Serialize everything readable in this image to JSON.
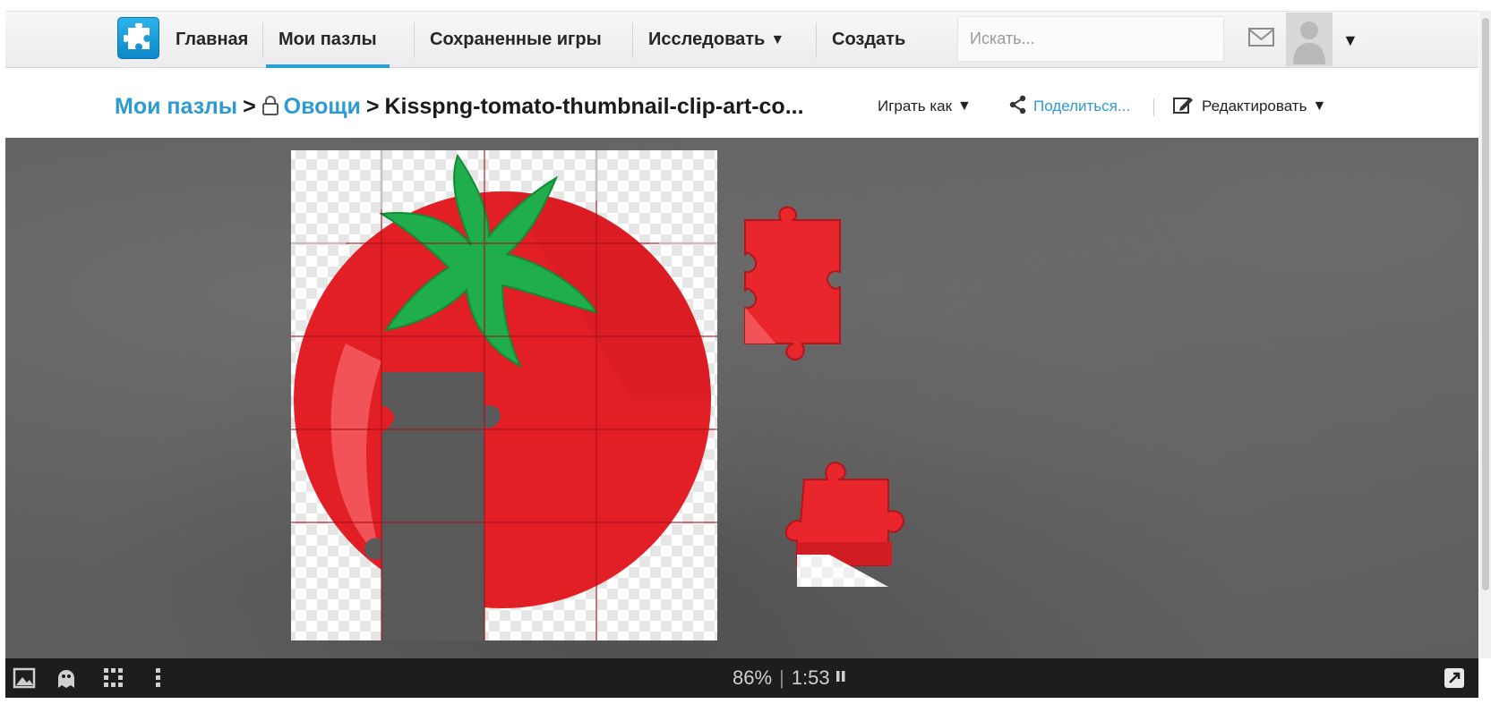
{
  "nav": {
    "home": "Главная",
    "my_puzzles": "Мои пазлы",
    "saved_games": "Сохраненные игры",
    "explore": "Исследовать",
    "create": "Создать"
  },
  "search": {
    "placeholder": "Искать..."
  },
  "breadcrumb": {
    "root": "Мои пазлы",
    "sep": ">",
    "folder": "Овощи",
    "title": "Kisspng-tomato-thumbnail-clip-art-co..."
  },
  "actions": {
    "play_as": "Играть как",
    "share": "Поделиться...",
    "edit": "Редактировать"
  },
  "status": {
    "completion": "86%",
    "timer": "1:53"
  },
  "icons": {
    "logo": "puzzle-logo-icon",
    "mail": "envelope-icon",
    "avatar": "user-silhouette-icon",
    "lock": "lock-icon",
    "share": "share-icon",
    "edit": "pencil-icon",
    "image": "image-icon",
    "ghost": "ghost-image-icon",
    "edges": "grid-icon",
    "menu": "vertical-dots-icon",
    "pause": "pause-icon",
    "fullscreen": "fullscreen-icon"
  },
  "colors": {
    "accent": "#2a9fd6",
    "tomato": "#e8262b",
    "leaf": "#1fae4b"
  }
}
